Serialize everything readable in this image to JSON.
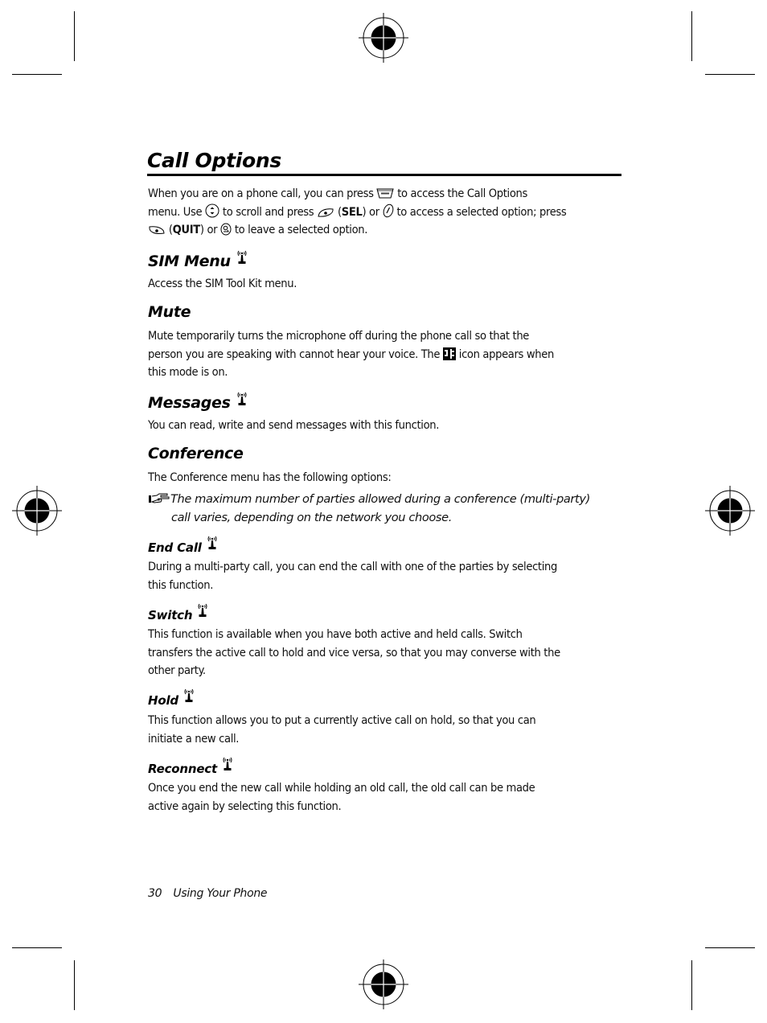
{
  "page": {
    "title": "Call Options",
    "intro": {
      "line1_a": "When you are on a phone call, you can press",
      "menu_key_icon": "menu-key-icon",
      "line1_b": "to access the Call Options",
      "line2_a": "menu. Use",
      "scroll_key_icon": "scroll-key-icon",
      "line2_b": "to scroll and press",
      "right_soft_key_icon": "right-soft-key-icon",
      "sel_open": "(",
      "sel_label": "SEL",
      "sel_close": ") or",
      "send_key_icon": "send-key-icon",
      "line2_c": "to access a selected option; press",
      "left_soft_key_icon": "left-soft-key-icon",
      "quit_open": "(",
      "quit_label": "QUIT",
      "quit_close": ") or",
      "end_key_icon": "end-key-icon",
      "line3_b": "to leave a selected option."
    },
    "sections": {
      "sim_menu": {
        "heading": "SIM Menu",
        "network_icon": "network-dependent-icon",
        "body": "Access the SIM Tool Kit menu."
      },
      "mute": {
        "heading": "Mute",
        "body_line1": "Mute temporarily turns the microphone off during the phone call so that the",
        "body_line2_a": "person you are speaking with cannot hear your voice. The",
        "mute_icon": "mute-indicator-icon",
        "body_line2_b": "icon appears when",
        "body_line3": "this mode is on."
      },
      "messages": {
        "heading": "Messages",
        "network_icon": "network-dependent-icon",
        "body": "You can read, write and send messages with this function."
      },
      "conference": {
        "heading": "Conference",
        "body": "The Conference menu has the following options:",
        "note_icon": "pointing-hand-note-icon",
        "note_line1": "The maximum number of parties allowed during a conference (multi-party)",
        "note_line2": "call varies, depending on the network you choose.",
        "subsections": [
          {
            "heading": "End Call",
            "network_icon": "network-dependent-icon",
            "body_line1": "During a multi-party call, you can end the call with one of the parties by selecting",
            "body_line2": "this function."
          },
          {
            "heading": "Switch",
            "network_icon": "network-dependent-icon",
            "body_line1": "This function is available when you have both active and held calls. Switch",
            "body_line2": "transfers the active call to hold and vice versa, so that you may converse with the",
            "body_line3": "other party."
          },
          {
            "heading": "Hold",
            "network_icon": "network-dependent-icon",
            "body_line1": "This function allows you to put a currently active call on hold, so that you can",
            "body_line2": "initiate a new call."
          },
          {
            "heading": "Reconnect",
            "network_icon": "network-dependent-icon",
            "body_line1": "Once you end the new call while holding an old call, the old call can be made",
            "body_line2": "active again by selecting this function."
          }
        ]
      }
    },
    "footer": {
      "page_number": "30",
      "section_name": "Using Your Phone"
    }
  }
}
